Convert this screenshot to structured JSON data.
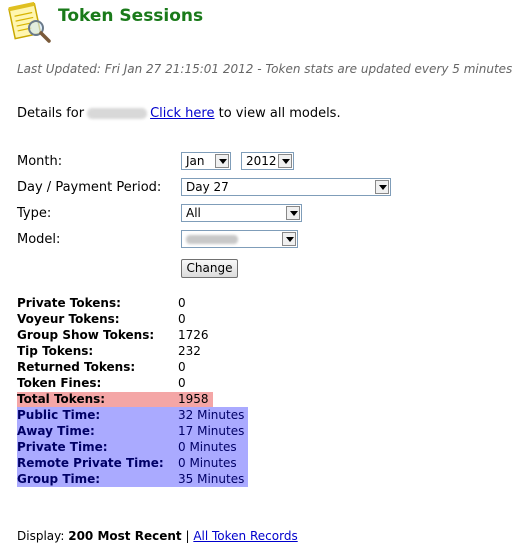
{
  "header": {
    "title": "Token Sessions",
    "logo_icon": "notepad-magnifier-icon"
  },
  "last_updated": "Last Updated: Fri Jan 27 21:15:01 2012 - Token stats are updated every 5 minutes",
  "details": {
    "prefix": "Details for",
    "link": "Click here",
    "suffix": "to view all models."
  },
  "filters": {
    "month_label": "Month:",
    "month_value": "Jan",
    "year_value": "2012",
    "day_label": "Day / Payment Period:",
    "day_value": "Day 27",
    "type_label": "Type:",
    "type_value": "All",
    "model_label": "Model:",
    "change_button": "Change"
  },
  "stats": [
    {
      "label": "Private Tokens:",
      "value": "0"
    },
    {
      "label": "Voyeur Tokens:",
      "value": "0"
    },
    {
      "label": "Group Show Tokens:",
      "value": "1726"
    },
    {
      "label": "Tip Tokens:",
      "value": "232"
    },
    {
      "label": "Returned Tokens:",
      "value": "0"
    },
    {
      "label": "Token Fines:",
      "value": "0"
    },
    {
      "label": "Total Tokens:",
      "value": "1958"
    },
    {
      "label": "Public Time:",
      "value": "32 Minutes"
    },
    {
      "label": "Away Time:",
      "value": "17 Minutes"
    },
    {
      "label": "Private Time:",
      "value": "0 Minutes"
    },
    {
      "label": "Remote Private Time:",
      "value": "0 Minutes"
    },
    {
      "label": "Group Time:",
      "value": "35 Minutes"
    }
  ],
  "footer": {
    "display_prefix": "Display:",
    "display_value": "200 Most Recent",
    "separator": "|",
    "link": "All Token Records"
  },
  "colors": {
    "title": "#1a7a1a",
    "total_highlight": "#f4a6a6",
    "time_highlight": "#aaaaff"
  }
}
